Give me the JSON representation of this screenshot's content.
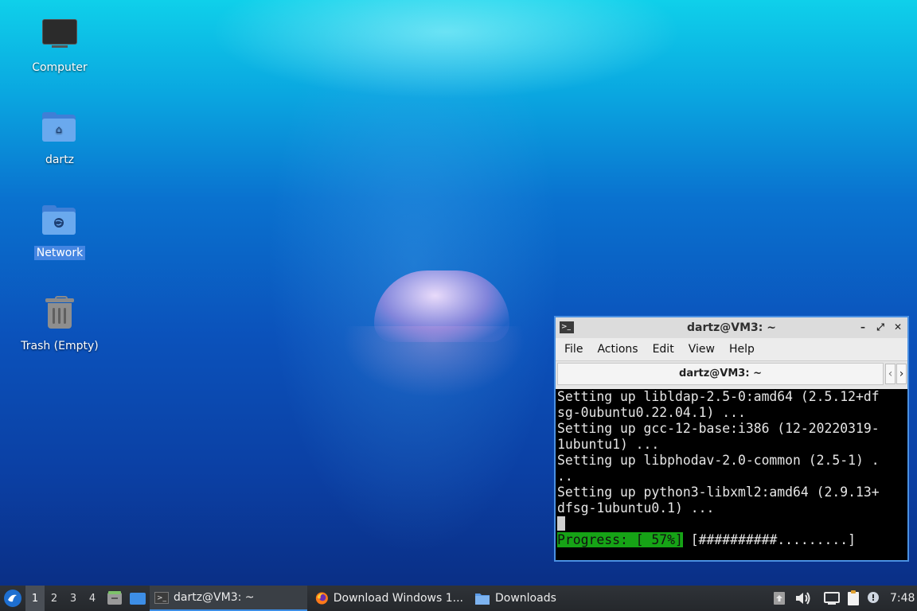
{
  "desktop": {
    "icons": [
      {
        "label": "Computer",
        "icon": "computer-icon"
      },
      {
        "label": "dartz",
        "icon": "home-folder-icon"
      },
      {
        "label": "Network",
        "icon": "network-folder-icon"
      },
      {
        "label": "Trash (Empty)",
        "icon": "trash-icon"
      }
    ]
  },
  "terminal": {
    "title": "dartz@VM3: ~",
    "menu": [
      "File",
      "Actions",
      "Edit",
      "View",
      "Help"
    ],
    "tab_title": "dartz@VM3: ~",
    "lines": [
      "Setting up libldap-2.5-0:amd64 (2.5.12+df",
      "sg-0ubuntu0.22.04.1) ...",
      "Setting up gcc-12-base:i386 (12-20220319-",
      "1ubuntu1) ...",
      "Setting up libphodav-2.0-common (2.5-1) .",
      "..",
      "Setting up python3-libxml2:amd64 (2.9.13+",
      "dfsg-1ubuntu0.1) ..."
    ],
    "progress_label": "Progress: [ 57%]",
    "progress_value": 0.57,
    "progress_bar": "[##########.........]"
  },
  "taskbar": {
    "workspaces": [
      "1",
      "2",
      "3",
      "4"
    ],
    "active_workspace": "1",
    "tasks": [
      {
        "label": "dartz@VM3: ~",
        "icon": "terminal-icon"
      },
      {
        "label": "Download Windows 1...",
        "icon": "firefox-icon"
      },
      {
        "label": "Downloads",
        "icon": "folder-icon"
      }
    ],
    "clock": "7:48"
  },
  "colors": {
    "terminal_border": "#4a90e2",
    "progress_fill": "#16a316",
    "taskbar_bg": "#2a2d31"
  }
}
